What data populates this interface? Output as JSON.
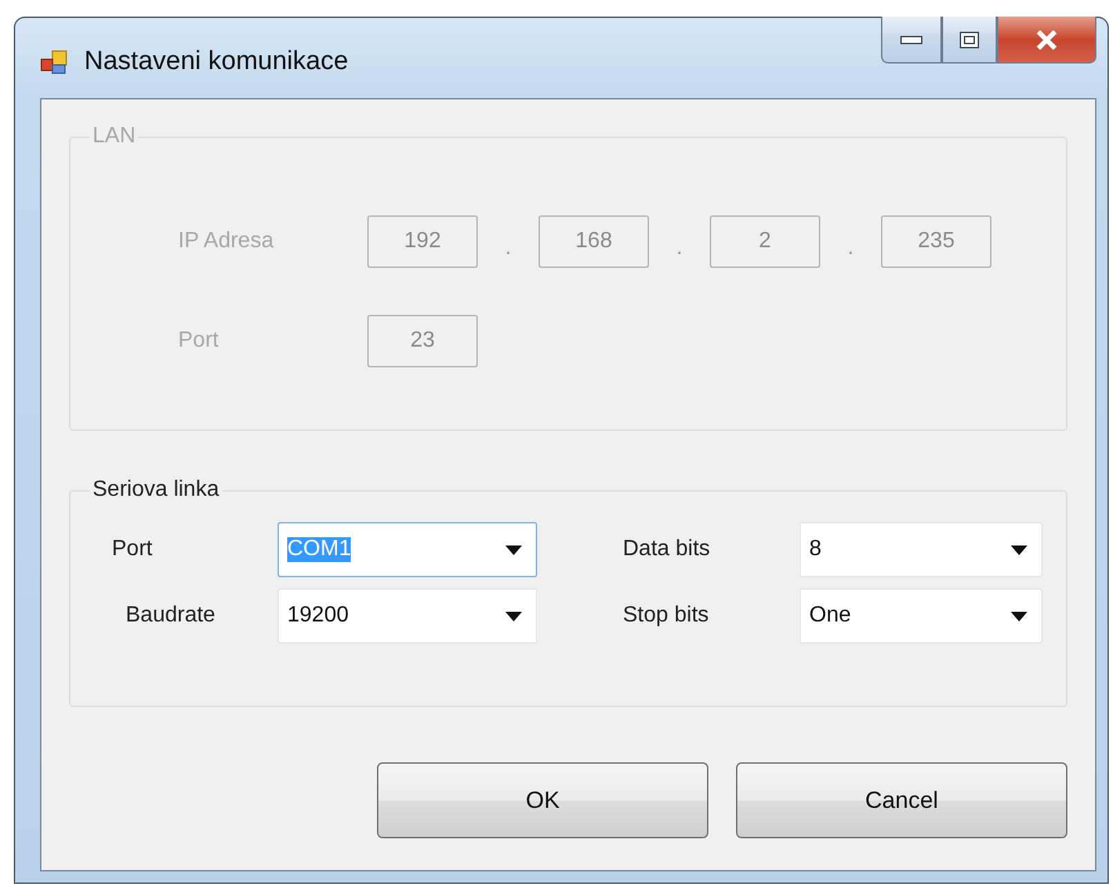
{
  "window": {
    "title": "Nastaveni komunikace"
  },
  "lan": {
    "legend": "LAN",
    "disabled": true,
    "ip_label": "IP Adresa",
    "ip_octets": [
      "192",
      "168",
      "2",
      "235"
    ],
    "separators": [
      ".",
      ".",
      "."
    ],
    "port_label": "Port",
    "port": "23"
  },
  "serial": {
    "legend": "Seriova linka",
    "fields": [
      {
        "label": "Port",
        "value": "COM1",
        "text_selected": true
      },
      {
        "label": "Data bits",
        "value": "8",
        "text_selected": false
      },
      {
        "label": "Baudrate",
        "value": "19200",
        "text_selected": false
      },
      {
        "label": "Stop bits",
        "value": "One",
        "text_selected": false
      }
    ]
  },
  "buttons": [
    "OK",
    "Cancel"
  ]
}
